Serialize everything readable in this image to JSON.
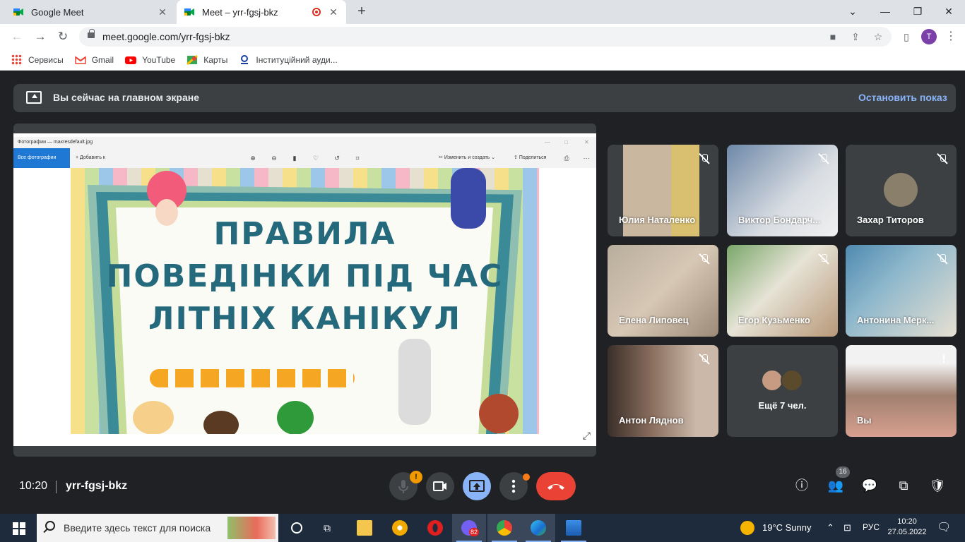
{
  "browser": {
    "tabs": [
      {
        "title": "Google Meet",
        "active": false
      },
      {
        "title": "Meet – yrr-fgsj-bkz",
        "active": true
      }
    ],
    "url": "meet.google.com/yrr-fgsj-bkz",
    "profile_initial": "T",
    "bookmarks": [
      "Сервисы",
      "Gmail",
      "YouTube",
      "Карты",
      "Інституційний ауди..."
    ]
  },
  "meet": {
    "banner": {
      "text": "Вы сейчас на главном экране",
      "stop_label": "Остановить показ"
    },
    "presentation": {
      "window_title": "Фотографии — maxresdefault.jpg",
      "all_photos": "Все фотографии",
      "add_to": "Добавить к",
      "edit_create": "Изменить и создать",
      "share": "Поделиться",
      "slide_lines": [
        "ПРАВИЛА",
        "ПОВЕДІНКИ ПІД ЧАС",
        "ЛІТНІХ КАНІКУЛ"
      ]
    },
    "participants": [
      {
        "name": "Юлия Наталенко",
        "muted": true
      },
      {
        "name": "Виктор Бондарч...",
        "muted": true
      },
      {
        "name": "Захар Титоров",
        "muted": true
      },
      {
        "name": "Елена Липовец",
        "muted": true
      },
      {
        "name": "Егор Кузьменко",
        "muted": true
      },
      {
        "name": "Антонина Мерк...",
        "muted": true
      },
      {
        "name": "Антон Ляднов",
        "muted": true
      },
      {
        "name": "Ещё 7 чел.",
        "muted": false
      },
      {
        "name": "Вы",
        "muted": false
      }
    ],
    "time": "10:20",
    "meeting_code": "yrr-fgsj-bkz",
    "mic_badge": "!",
    "people_count": "16"
  },
  "taskbar": {
    "search_placeholder": "Введите здесь текст для поиска",
    "viber_badge": "82",
    "weather": "19°C  Sunny",
    "language": "РУС",
    "time": "10:20",
    "date": "27.05.2022"
  },
  "colors": {
    "meet_bg": "#202124",
    "tile_bg": "#3c4043",
    "accent_blue": "#8ab4f8",
    "hangup_red": "#ea4335",
    "slide_text": "#256a7c"
  }
}
